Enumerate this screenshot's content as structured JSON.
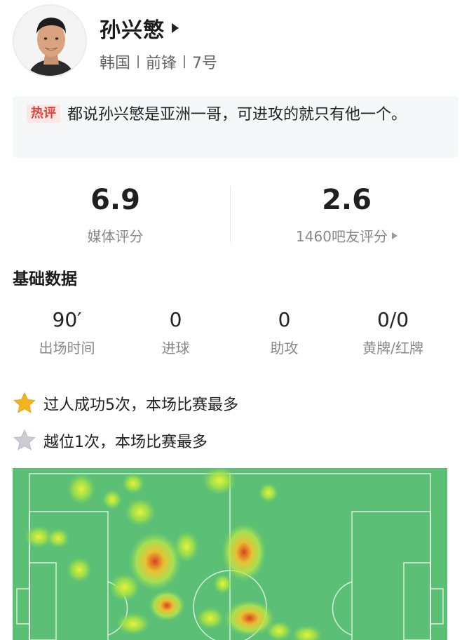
{
  "player": {
    "name": "孙兴慜",
    "country": "韩国",
    "position": "前锋",
    "number": "7号"
  },
  "hot_comment": {
    "badge": "热评",
    "text": "都说孙兴慜是亚洲一哥，可进攻的就只有他一个。"
  },
  "ratings": {
    "media": {
      "value": "6.9",
      "label": "媒体评分"
    },
    "fans": {
      "value": "2.6",
      "label": "1460吧友评分"
    }
  },
  "basic_stats": {
    "title": "基础数据",
    "items": [
      {
        "value": "90′",
        "label": "出场时间"
      },
      {
        "value": "0",
        "label": "进球"
      },
      {
        "value": "0",
        "label": "助攻"
      },
      {
        "value": "0/0",
        "label": "黄牌/红牌"
      }
    ]
  },
  "highlights": [
    {
      "icon": "gold-star-icon",
      "color": "#f5b41e",
      "text": "过人成功5次，本场比赛最多"
    },
    {
      "icon": "silver-star-icon",
      "color": "#c9ccd3",
      "text": "越位1次，本场比赛最多"
    }
  ],
  "colors": {
    "pitch_green": "#5cbf76",
    "hot_red": "#e4433a"
  }
}
